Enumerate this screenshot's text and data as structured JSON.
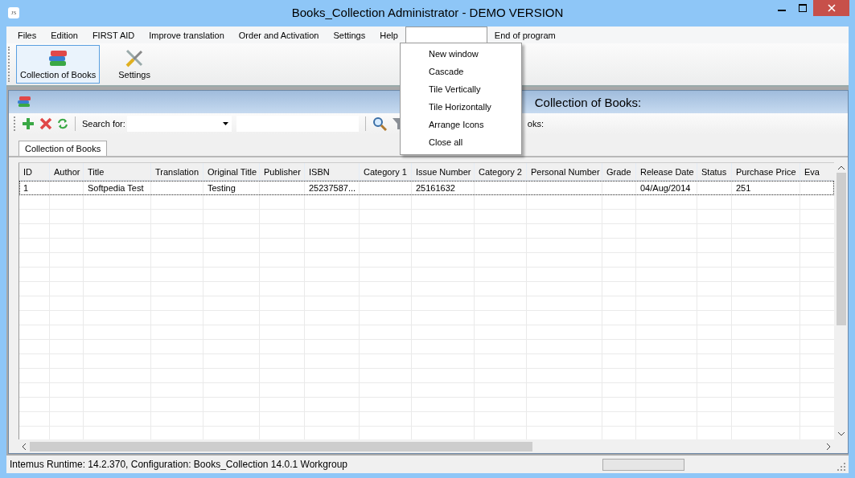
{
  "window": {
    "title": "Books_Collection  Administrator - DEMO VERSION",
    "icon_text": "JS"
  },
  "menu": [
    {
      "label": "Files",
      "open": false
    },
    {
      "label": "Edition",
      "open": false
    },
    {
      "label": "FIRST AID",
      "open": false
    },
    {
      "label": "Improve translation",
      "open": false
    },
    {
      "label": "Order and Activation",
      "open": false
    },
    {
      "label": "Settings",
      "open": false
    },
    {
      "label": "Help",
      "open": false
    },
    {
      "open": true
    },
    {
      "label": "End of program",
      "open": false
    }
  ],
  "dropdown": [
    "New window",
    "Cascade",
    "Tile Vertically",
    "Tile Horizontally",
    "Arrange Icons",
    "Close all"
  ],
  "toolbar": [
    {
      "label": "Collection of Books",
      "kind": "books",
      "selected": true
    },
    {
      "label": "Settings",
      "kind": "tools",
      "selected": false
    }
  ],
  "child": {
    "title": "Collection of Books:",
    "search_label": "Search for:",
    "count_label": "oks:",
    "tabs": [
      {
        "label": "Collection of Books",
        "selected": true
      }
    ],
    "table": {
      "columns": [
        "ID",
        "Author",
        "Title",
        "Translation",
        "Original Title",
        "Publisher",
        "ISBN",
        "Category 1",
        "Issue Number",
        "Category 2",
        "Personal Number",
        "Grade",
        "Release Date",
        "Status",
        "Purchase Price",
        "Eva"
      ],
      "rows": [
        {
          "cells": [
            "1",
            "",
            "Softpedia Test",
            "",
            "Testing",
            "",
            "25237587...",
            "",
            "25161632",
            "",
            "",
            "",
            "04/Aug/2014",
            "",
            "251",
            ""
          ],
          "selected": true
        }
      ]
    }
  },
  "status_bar": {
    "text": "Intemus Runtime: 14.2.370,  Configuration: Books_Collection 14.0.1 Workgroup",
    "level": 0
  }
}
